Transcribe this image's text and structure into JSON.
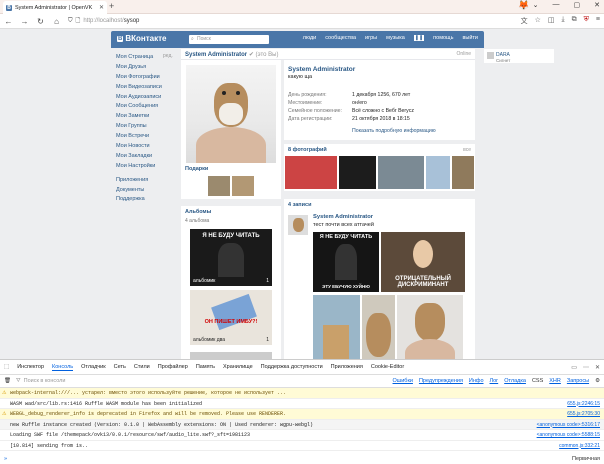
{
  "browser": {
    "tab_title": "System Administrator | OpenVK",
    "url_host": "http://localhost/",
    "url_path": "sysop"
  },
  "vk": {
    "logo": "ВКонтакте",
    "search_placeholder": "Поиск",
    "nav": [
      "люди",
      "сообщества",
      "игры",
      "музыка",
      "помощь",
      "выйти"
    ],
    "menu": [
      "Моя Страница",
      "Мои Друзья",
      "Мои Фотографии",
      "Мои Видеозаписи",
      "Мои Аудиозаписи",
      "Мои Сообщения",
      "Мои Заметки",
      "Мои Группы",
      "Мои Встречи",
      "Мои Новости",
      "Мои Закладки",
      "Мои Настройки"
    ],
    "menu_extra": [
      "Приложения",
      "Документы",
      "Поддержка"
    ],
    "edit_label": "ред.",
    "profile_header_name": "System Administrator",
    "profile_header_note": "(это Вы)",
    "online": "Online",
    "right_name": "DARA",
    "right_sub": "Сигнет",
    "name": "System Administrator",
    "status": "какую ща",
    "info": [
      {
        "k": "День рождения:",
        "v": "1 декабря 1256, 670 лет"
      },
      {
        "k": "Местоимение:",
        "v": "он/его"
      },
      {
        "k": "Семейное положение:",
        "v": "Всё сложно с Beбr Berycz"
      },
      {
        "k": "Дата регистрации:",
        "v": "21 октября 2018 в 18:15"
      }
    ],
    "more": "Показать подробную информацию",
    "gifts_label": "Подарки",
    "albums_label": "Альбомы",
    "albums_count": "4 альбома",
    "albums": [
      {
        "top": "я не буду читать",
        "cap": "альбомик",
        "cnt": "1"
      },
      {
        "top": "он пишет имбу?!",
        "cap": "альбомик два",
        "cnt": "1"
      }
    ],
    "photos_label": "8 фотографий",
    "photos_all": "все",
    "wall_label": "4 записи",
    "post_author": "System Administrator",
    "post_text": "тест почти всех аттачей",
    "meme1_top": "я не буду читать",
    "meme1_bot": "эту ебучую хуйню",
    "meme2": "отрицательный дискриминант"
  },
  "devtools": {
    "tabs": [
      "Инспектор",
      "Консоль",
      "Отладчик",
      "Сеть",
      "Стили",
      "Профайлер",
      "Память",
      "Хранилище",
      "Поддержка доступности",
      "Приложения",
      "Cookie-Editor"
    ],
    "filter_placeholder": "Поиск в консоли",
    "filters": [
      "Ошибки",
      "Предупреждения",
      "Инфо",
      "Лог",
      "Отладка",
      "CSS",
      "XHR",
      "Запросы"
    ],
    "rows": [
      {
        "text": "webpack-internal:///...  устарел: вместо этого используйте решение, которое не использует ...",
        "src": "",
        "warn": true
      },
      {
        "text": "WASM  wad/src/lib.rs:1416  Ruffle WASM module has been initialized",
        "src": "655.js:2246:15",
        "warn": false
      },
      {
        "text": "WEBGL_debug_renderer_info is deprecated in Firefox and will be removed. Please use RENDERER.",
        "src": "655.js:2705:30",
        "warn": true
      },
      {
        "text": "new Ruffle instance created (Version: 0.1.0 | WebAssembly extensions: ON | Used renderer: wgpu-webgl)",
        "src": "<anonymous code>:5316:17",
        "warn": false
      },
      {
        "text": "Loading SWF file /themepack/ovk13/0.0.1/resource/swf/audio_lite.swf?_sft=1981123",
        "src": "<anonymous code>:5588:15",
        "warn": false
      },
      {
        "text": "[10.814]  sending from is..",
        "src": "common.js:332:21",
        "warn": false
      }
    ],
    "bottom_right": "Первичная"
  }
}
